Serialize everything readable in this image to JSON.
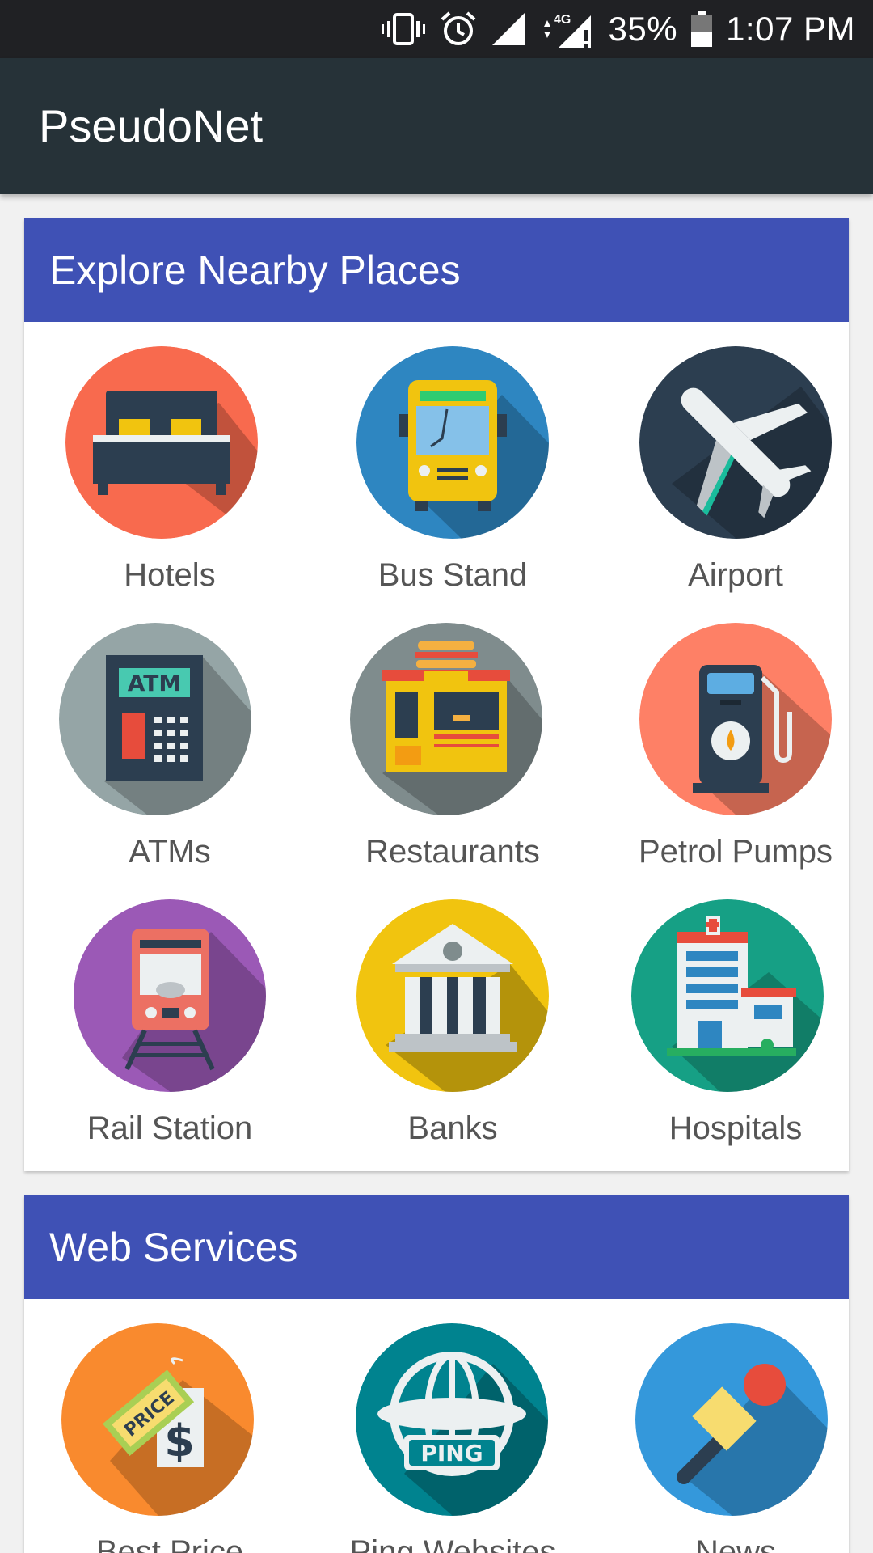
{
  "status_bar": {
    "battery": "35%",
    "time": "1:07 PM",
    "network": "4G"
  },
  "app_bar": {
    "title": "PseudoNet"
  },
  "sections": [
    {
      "title": "Explore Nearby Places",
      "items": [
        {
          "label": "Hotels",
          "icon": "bed-icon",
          "color": "#f86a4e"
        },
        {
          "label": "Bus Stand",
          "icon": "bus-icon",
          "color": "#2e86c1"
        },
        {
          "label": "Airport",
          "icon": "airplane-icon",
          "color": "#2c3e50"
        },
        {
          "label": "ATMs",
          "icon": "atm-icon",
          "color": "#95a5a6"
        },
        {
          "label": "Restaurants",
          "icon": "restaurant-icon",
          "color": "#7f8c8d"
        },
        {
          "label": "Petrol Pumps",
          "icon": "fuel-pump-icon",
          "color": "#fe8066"
        },
        {
          "label": "Rail Station",
          "icon": "train-icon",
          "color": "#9b59b6"
        },
        {
          "label": "Banks",
          "icon": "bank-icon",
          "color": "#f1c40f"
        },
        {
          "label": "Hospitals",
          "icon": "hospital-icon",
          "color": "#16a085"
        }
      ]
    },
    {
      "title": "Web Services",
      "items": [
        {
          "label": "Best Price",
          "icon": "price-tag-icon",
          "color": "#f98a2e"
        },
        {
          "label": "Ping Websites",
          "icon": "ping-globe-icon",
          "color": "#00838f"
        },
        {
          "label": "News",
          "icon": "microphone-icon",
          "color": "#3498db"
        }
      ]
    }
  ]
}
